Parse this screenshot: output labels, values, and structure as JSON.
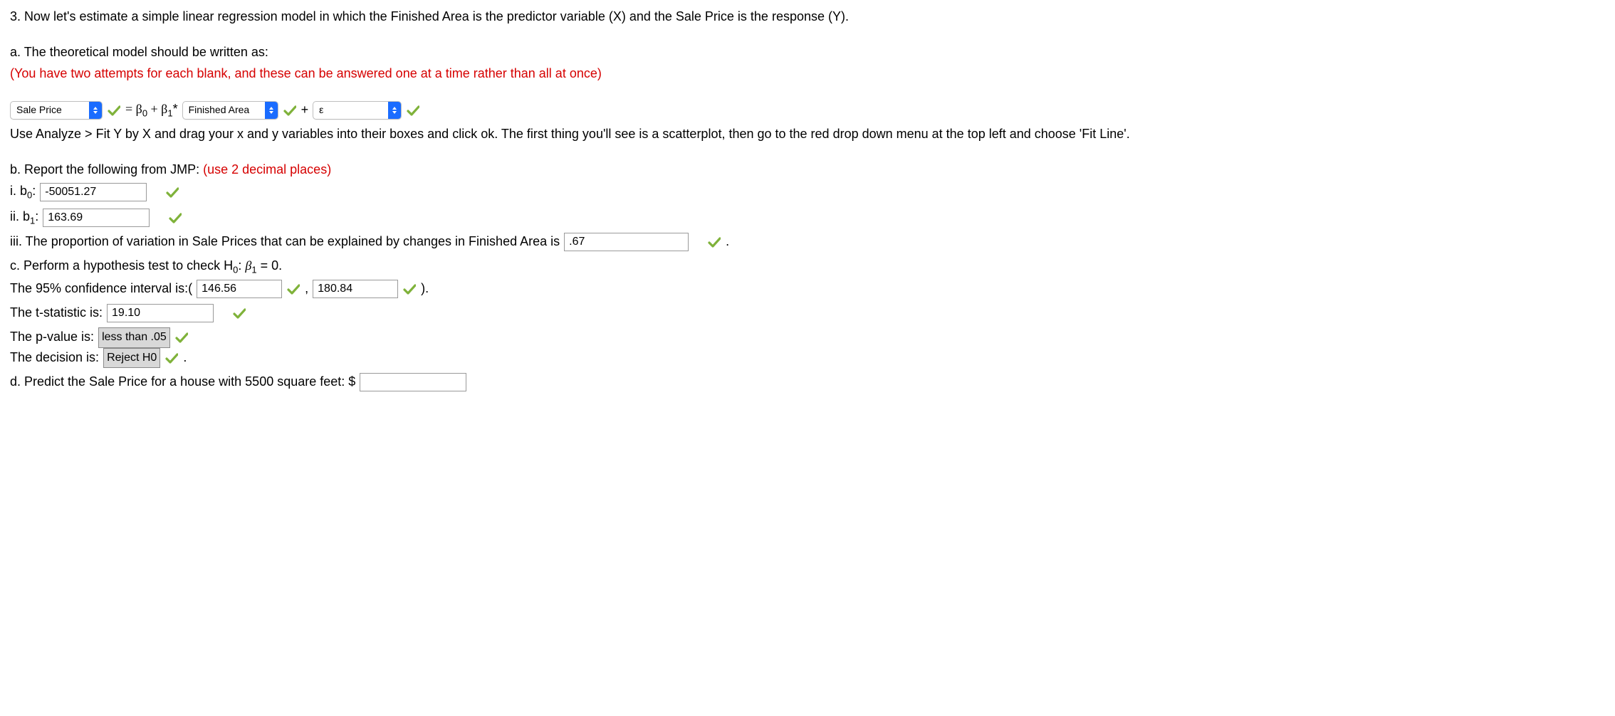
{
  "q": {
    "intro": "3. Now let's estimate a simple linear regression model in which the Finished Area is the predictor variable (X) and the Sale Price is the response (Y).",
    "a_label": "a. The theoretical model should be written as:",
    "a_note": "(You have two attempts for each blank, and these can be answered one at a time rather than all at once)",
    "model": {
      "dd_y": "Sale Price",
      "eq_mid": " = β",
      "sub0": "0",
      "plus": " + β",
      "sub1": "1",
      "star": "* ",
      "dd_x": "Finished Area",
      "plus2": "+",
      "dd_err": "ε"
    },
    "analyze_hint": "Use Analyze > Fit Y by X and drag your x and y variables into their boxes and click ok. The first thing you'll see is a scatterplot, then go to the red drop down menu at the top left and choose 'Fit Line'.",
    "b_label": "b. Report the following from JMP: ",
    "b_note": "(use 2 decimal places)",
    "bi_label": "i. b",
    "bi_sub": "0",
    "bi_colon": ": ",
    "b0_value": "-50051.27",
    "bii_label": "ii. b",
    "bii_sub": "1",
    "bii_colon": ": ",
    "b1_value": "163.69",
    "biii_text": "iii. The proportion of variation in Sale Prices that can be explained by changes in Finished Area is ",
    "biii_value": ".67",
    "biii_period": " .",
    "c_label_pre": "c. Perform a hypothesis test to check H",
    "c_sub": "0",
    "c_colon": ": ",
    "c_beta": "β",
    "c_beta_sub": "1",
    "c_eq": " = 0.",
    "ci_label": "The 95% confidence interval is:( ",
    "ci_lo": "146.56",
    "ci_comma": " , ",
    "ci_hi": "180.84",
    "ci_close": " ).",
    "tstat_label": "The t-statistic is: ",
    "tstat_value": "19.10",
    "pval_label": "The p-value is: ",
    "pval_value": "less than .05",
    "dec_label": "The decision is: ",
    "dec_value": "Reject H0",
    "dec_period": " .",
    "d_label": "d. Predict the Sale Price for a house with 5500 square feet: $ ",
    "d_value": ""
  }
}
